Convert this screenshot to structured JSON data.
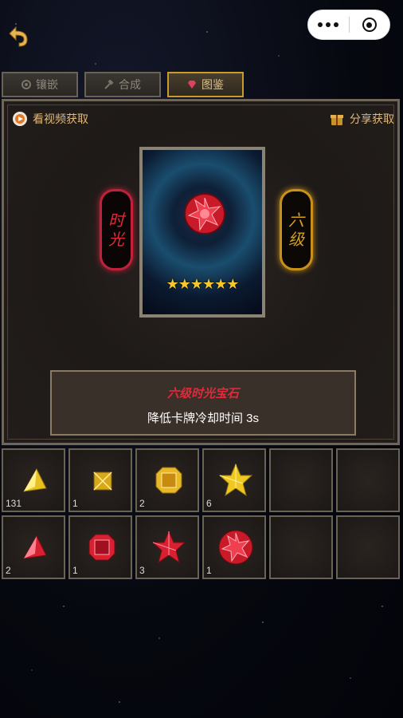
{
  "topbar": {
    "back_icon": "back-arrow-icon",
    "capsule": [
      "more-icon",
      "close-icon"
    ]
  },
  "tabs": [
    {
      "label": "镶嵌",
      "icon": "gear-icon",
      "active": false
    },
    {
      "label": "合成",
      "icon": "hammer-icon",
      "active": false
    },
    {
      "label": "图鉴",
      "icon": "diamond-icon",
      "active": true
    }
  ],
  "panel": {
    "watch_video": "看视频获取",
    "share": "分享获取",
    "card": {
      "gem": "red-six-star-gem",
      "stars": "★★★★★★"
    },
    "seal_left": [
      "时",
      "光"
    ],
    "seal_right": [
      "六",
      "级"
    ],
    "info_title": "六级时光宝石",
    "info_desc": "降低卡牌冷却时间 3s"
  },
  "inventory": {
    "row1": [
      {
        "gem": "yellow-triangle-gem",
        "count": "131"
      },
      {
        "gem": "yellow-square-gem",
        "count": "1"
      },
      {
        "gem": "yellow-octagon-gem",
        "count": "2"
      },
      {
        "gem": "yellow-star-gem",
        "count": "6"
      },
      {
        "gem": "",
        "count": ""
      },
      {
        "gem": "",
        "count": ""
      }
    ],
    "row2": [
      {
        "gem": "red-triangle-gem",
        "count": "2"
      },
      {
        "gem": "red-octagon-gem",
        "count": "1"
      },
      {
        "gem": "red-star-gem",
        "count": "3"
      },
      {
        "gem": "red-round-gem",
        "count": "1"
      },
      {
        "gem": "",
        "count": ""
      },
      {
        "gem": "",
        "count": ""
      }
    ]
  },
  "colors": {
    "accent_gold": "#c99a2c",
    "red": "#e02a3a",
    "star": "#f6c82e"
  }
}
